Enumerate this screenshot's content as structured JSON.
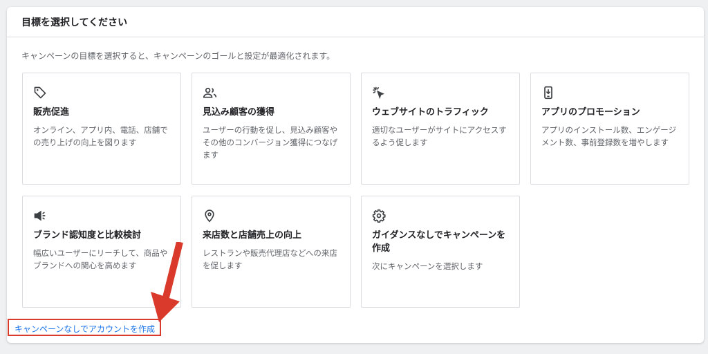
{
  "header": {
    "title": "目標を選択してください"
  },
  "subtitle": "キャンペーンの目標を選択すると、キャンペーンのゴールと設定が最適化されます。",
  "goals": [
    {
      "icon": "tag-icon",
      "title": "販売促進",
      "description": "オンライン、アプリ内、電話、店舗での売り上げの向上を図ります"
    },
    {
      "icon": "people-icon",
      "title": "見込み顧客の獲得",
      "description": "ユーザーの行動を促し、見込み顧客やその他のコンバージョン獲得につなげます"
    },
    {
      "icon": "cursor-click-icon",
      "title": "ウェブサイトのトラフィック",
      "description": "適切なユーザーがサイトにアクセスするよう促します"
    },
    {
      "icon": "mobile-download-icon",
      "title": "アプリのプロモーション",
      "description": "アプリのインストール数、エンゲージメント数、事前登録数を増やします"
    },
    {
      "icon": "megaphone-icon",
      "title": "ブランド認知度と比較検討",
      "description": "幅広いユーザーにリーチして、商品やブランドへの関心を高めます"
    },
    {
      "icon": "location-pin-icon",
      "title": "来店数と店舗売上の向上",
      "description": "レストランや販売代理店などへの来店を促します"
    },
    {
      "icon": "gear-icon",
      "title": "ガイダンスなしでキャンペーンを作成",
      "description": "次にキャンペーンを選択します"
    }
  ],
  "footer": {
    "create_account_link": "キャンペーンなしでアカウントを作成"
  },
  "colors": {
    "link": "#1a73e8",
    "highlight": "#d93a2b",
    "card_border": "#dadce0"
  }
}
